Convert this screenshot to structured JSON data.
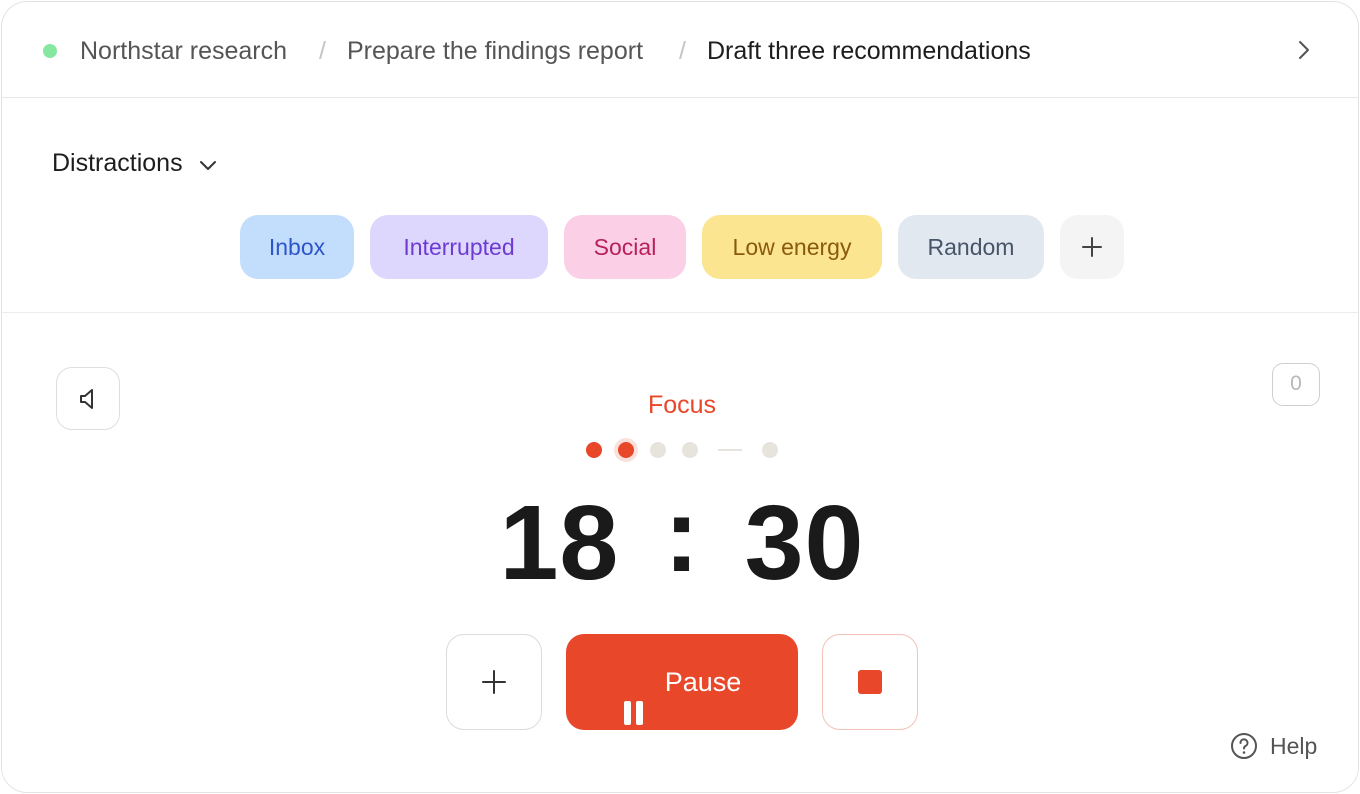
{
  "header": {
    "status_color": "#86e8a0",
    "breadcrumbs": [
      {
        "label": "Northstar research"
      },
      {
        "label": "Prepare the findings report"
      },
      {
        "label": "Draft three recommendations"
      }
    ],
    "separator": "/",
    "next_icon": "chevron-right-icon"
  },
  "distractions": {
    "title": "Distractions",
    "toggle_icon": "chevron-down-icon",
    "tags": [
      {
        "label": "Inbox",
        "bg": "#c3ddfd",
        "fg": "#2d55c9"
      },
      {
        "label": "Interrupted",
        "bg": "#ddd6fd",
        "fg": "#6d3bd1"
      },
      {
        "label": "Social",
        "bg": "#fbd0e7",
        "fg": "#b8205d"
      },
      {
        "label": "Low energy",
        "bg": "#fbe591",
        "fg": "#8a5a0b"
      },
      {
        "label": "Random",
        "bg": "#e2e8f0",
        "fg": "#475569"
      }
    ],
    "add_icon": "plus-icon"
  },
  "timer": {
    "sound_icon": "speaker-icon",
    "count": "0",
    "mode": "Focus",
    "accent": "#e8472a",
    "sessions": {
      "completed": 1,
      "current": 2,
      "total": 5
    },
    "minutes": "18",
    "colon": ":",
    "seconds": "30"
  },
  "controls": {
    "add_icon": "plus-icon",
    "pause_label": "Pause",
    "pause_icon": "pause-icon",
    "stop_icon": "stop-icon"
  },
  "help": {
    "label": "Help",
    "icon": "question-circle-icon"
  }
}
